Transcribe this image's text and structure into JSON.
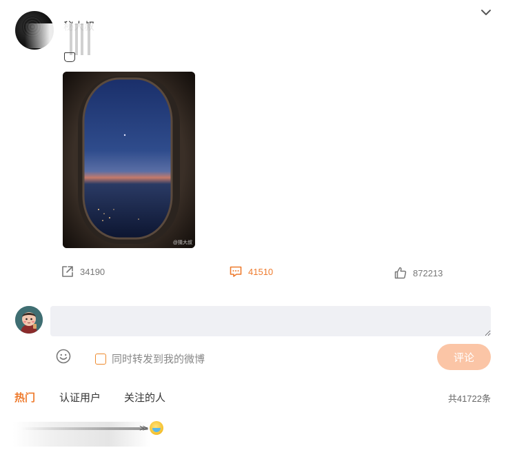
{
  "post": {
    "author_name": "秘大叔",
    "image_watermark": "@猜大叔",
    "actions": {
      "share_count": "34190",
      "comment_count": "41510",
      "like_count": "872213"
    }
  },
  "composer": {
    "input_value": "",
    "input_placeholder": "",
    "repost_label": "同时转发到我的微博",
    "repost_checked": false,
    "submit_label": "评论"
  },
  "comments": {
    "tabs": [
      {
        "label": "热门",
        "active": true
      },
      {
        "label": "认证用户",
        "active": false
      },
      {
        "label": "关注的人",
        "active": false
      }
    ],
    "total_label": "共41722条"
  },
  "colors": {
    "accent": "#ee7a2c",
    "submit_disabled": "#fbc5a6",
    "input_bg": "#eff0f4"
  },
  "icons": {
    "collapse": "chevron-down-icon",
    "share": "share-icon",
    "comment": "comment-icon",
    "like": "thumbs-up-icon",
    "emoji": "emoji-icon"
  }
}
